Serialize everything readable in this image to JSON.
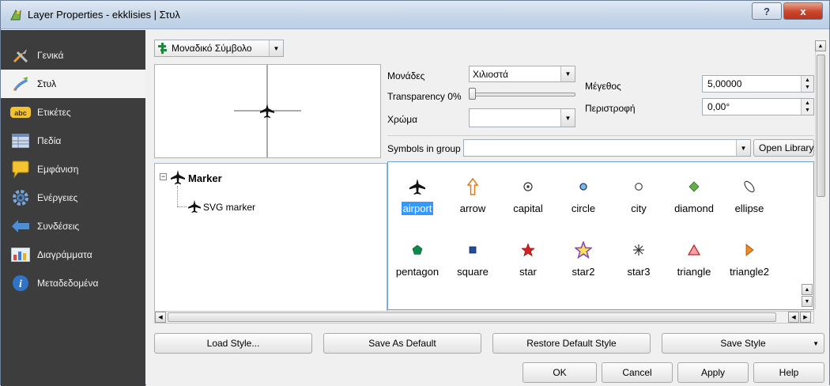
{
  "window": {
    "title": "Layer Properties - ekklisies | Στυλ",
    "help_button": "?",
    "close_button": "x"
  },
  "sidebar": {
    "items": [
      {
        "label": "Γενικά",
        "icon": "tools-icon"
      },
      {
        "label": "Στυλ",
        "icon": "paintbrush-icon",
        "active": true
      },
      {
        "label": "Ετικέτες",
        "icon": "abc-label-icon"
      },
      {
        "label": "Πεδία",
        "icon": "table-icon"
      },
      {
        "label": "Εμφάνιση",
        "icon": "speech-bubble-icon"
      },
      {
        "label": "Ενέργειες",
        "icon": "gear-icon"
      },
      {
        "label": "Συνδέσεις",
        "icon": "join-icon"
      },
      {
        "label": "Διαγράμματα",
        "icon": "chart-icon"
      },
      {
        "label": "Μεταδεδομένα",
        "icon": "info-icon"
      }
    ]
  },
  "renderer": {
    "selected": "Μοναδικό Σύμβολο"
  },
  "layer_tree": {
    "root": "Marker",
    "child": "SVG marker"
  },
  "properties": {
    "units_label": "Μονάδες",
    "units_value": "Χιλιοστά",
    "transparency_label": "Transparency 0%",
    "color_label": "Χρώμα",
    "size_label": "Μέγεθος",
    "size_value": "5,00000",
    "rotation_label": "Περιστροφή",
    "rotation_value": "0,00°"
  },
  "symbols": {
    "group_label": "Symbols in group",
    "group_value": "",
    "open_library": "Open Library",
    "items": [
      {
        "name": "airport",
        "icon": "airplane-icon",
        "selected": true
      },
      {
        "name": "arrow",
        "icon": "arrow-up-icon"
      },
      {
        "name": "capital",
        "icon": "capital-icon"
      },
      {
        "name": "circle",
        "icon": "circle-icon"
      },
      {
        "name": "city",
        "icon": "city-icon"
      },
      {
        "name": "diamond",
        "icon": "diamond-icon"
      },
      {
        "name": "ellipse",
        "icon": "ellipse-icon"
      },
      {
        "name": "pentagon",
        "icon": "pentagon-icon"
      },
      {
        "name": "square",
        "icon": "square-icon"
      },
      {
        "name": "star",
        "icon": "star-icon"
      },
      {
        "name": "star2",
        "icon": "star-outline-icon"
      },
      {
        "name": "star3",
        "icon": "asterisk-icon"
      },
      {
        "name": "triangle",
        "icon": "triangle-icon"
      },
      {
        "name": "triangle2",
        "icon": "triangle-right-icon"
      }
    ]
  },
  "style_buttons": {
    "load": "Load Style...",
    "save_default": "Save As Default",
    "restore_default": "Restore Default Style",
    "save": "Save Style"
  },
  "dialog_buttons": {
    "ok": "OK",
    "cancel": "Cancel",
    "apply": "Apply",
    "help": "Help"
  },
  "colors": {
    "sidebar_bg": "#3d3d3d",
    "selection": "#3399ff",
    "star": "#d62020",
    "pentagon": "#0a8a4a",
    "square": "#1f4e9c",
    "diamond": "#5fb04a",
    "triangle2": "#f08a1e",
    "triangle": "#d9534f",
    "star2": "#8a3fc0"
  }
}
